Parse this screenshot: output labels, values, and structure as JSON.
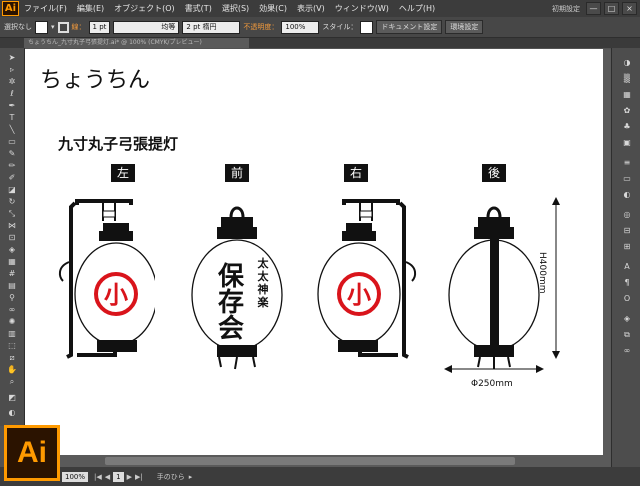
{
  "app": {
    "logo": "Ai",
    "menus": [
      "ファイル(F)",
      "編集(E)",
      "オブジェクト(O)",
      "書式(T)",
      "選択(S)",
      "効果(C)",
      "表示(V)",
      "ウィンドウ(W)",
      "ヘルプ(H)"
    ],
    "workspace": "初期設定",
    "window_controls": [
      "—",
      "□",
      "×"
    ]
  },
  "control": {
    "selection": "選択なし",
    "stroke_label": "線：",
    "stroke_weight": "1 pt",
    "line_profile": "均等",
    "brush": "2 pt 楕円",
    "opacity_label": "不透明度：",
    "opacity": "100%",
    "style_label": "スタイル：",
    "doc_setup": "ドキュメント設定",
    "prefs": "環境設定"
  },
  "document": {
    "tab_title": "ちょうちん_九寸丸子弓張提灯.ai* @ 100% (CMYK/プレビュー)"
  },
  "artboard": {
    "title": "ちょうちん",
    "subtitle": "九寸丸子弓張提灯",
    "views": [
      "左",
      "前",
      "右",
      "後"
    ],
    "emblem": "小",
    "front_main": "保存会",
    "front_side": "太太神楽",
    "dim_height": "H400mm",
    "dim_width": "Φ250mm"
  },
  "status": {
    "zoom": "100%",
    "page": "1",
    "tool": "手のひら"
  },
  "colors": {
    "emblem_red": "#d9141b",
    "accent": "#ff9a00"
  }
}
